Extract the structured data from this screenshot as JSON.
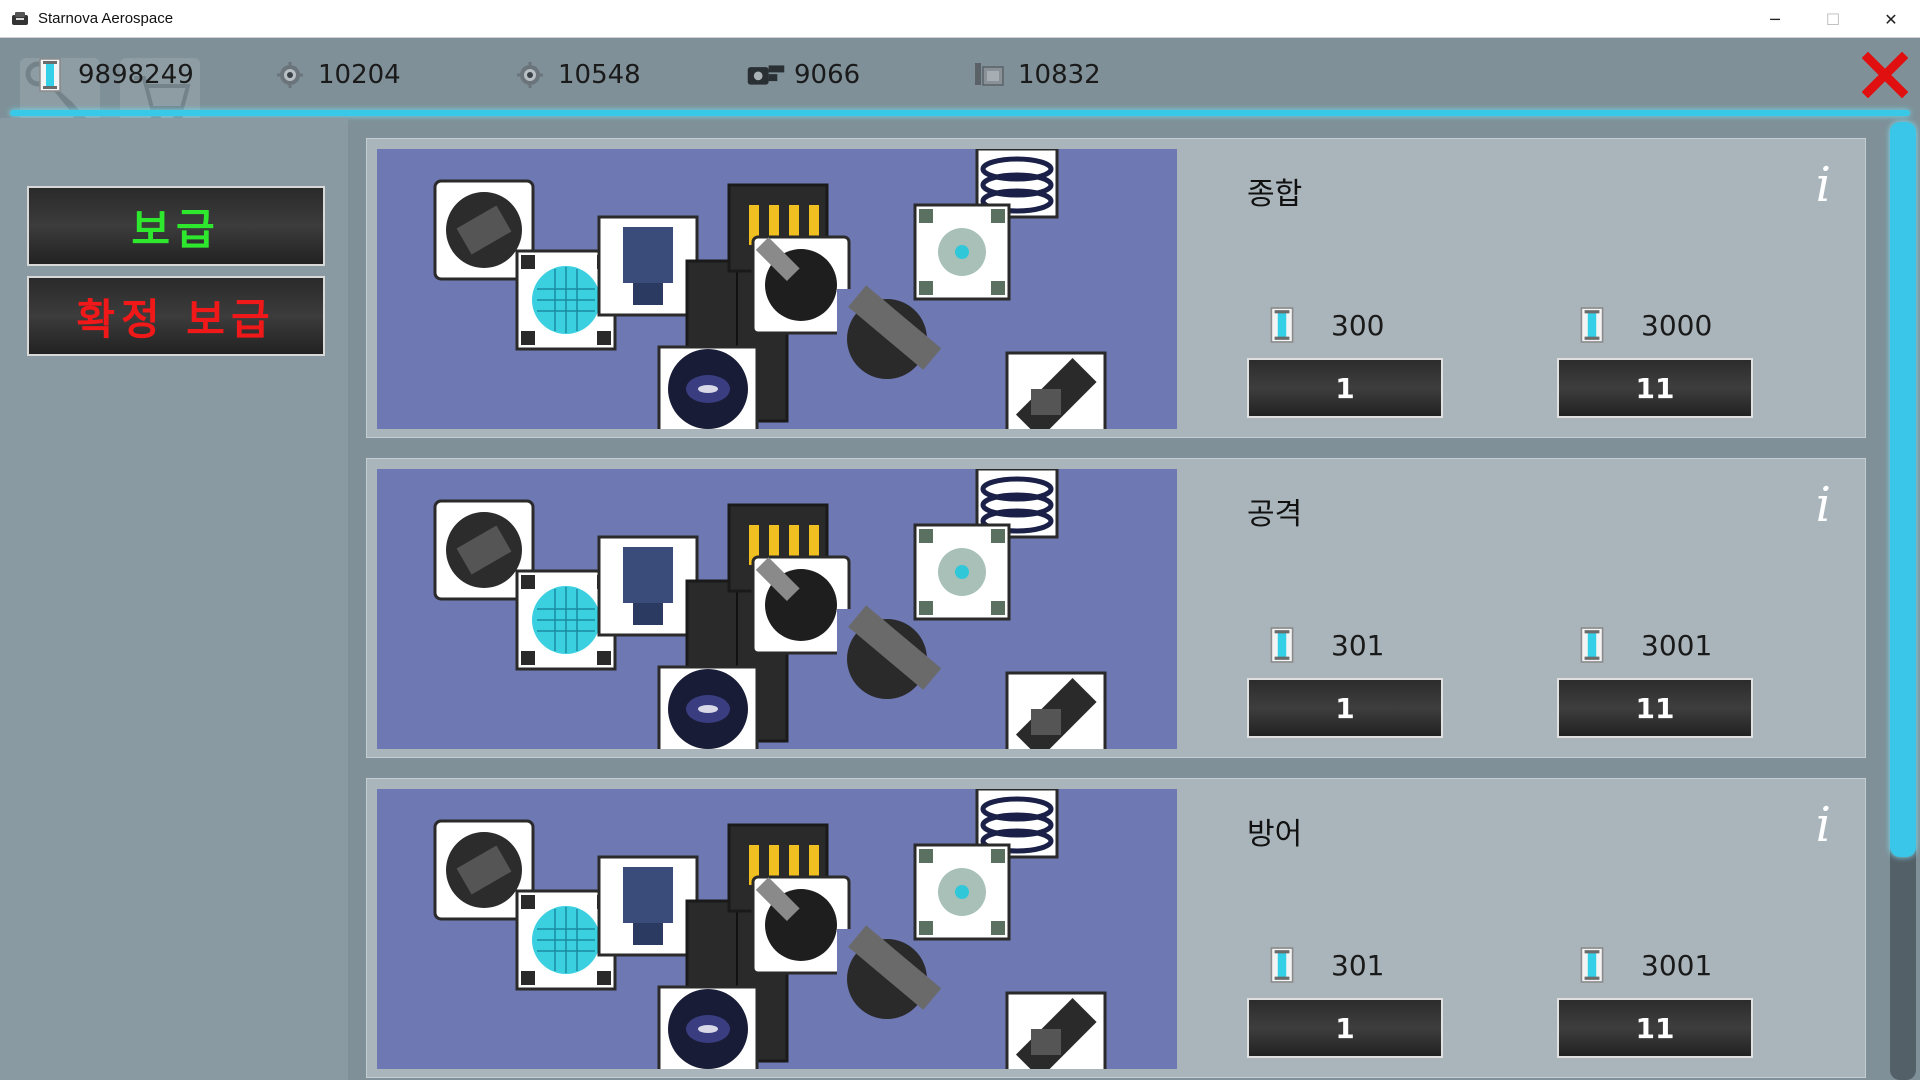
{
  "window": {
    "title": "Starnova Aerospace",
    "controls": {
      "minimize": "─",
      "maximize": "☐",
      "close": "✕"
    }
  },
  "resources": [
    {
      "icon": "crystal-icon",
      "value": "9898249"
    },
    {
      "icon": "gear-part-icon",
      "value": "10204"
    },
    {
      "icon": "gear-part-icon",
      "value": "10548"
    },
    {
      "icon": "gun-icon",
      "value": "9066"
    },
    {
      "icon": "module-icon",
      "value": "10832"
    }
  ],
  "sidebar": {
    "supply_label": "보급",
    "guaranteed_supply_label": "확정 보급"
  },
  "cards": [
    {
      "name": "종합",
      "info": "i",
      "single": {
        "cost": "300",
        "label": "1"
      },
      "multi": {
        "cost": "3000",
        "label": "11"
      }
    },
    {
      "name": "공격",
      "info": "i",
      "single": {
        "cost": "301",
        "label": "1"
      },
      "multi": {
        "cost": "3001",
        "label": "11"
      }
    },
    {
      "name": "방어",
      "info": "i",
      "single": {
        "cost": "301",
        "label": "1"
      },
      "multi": {
        "cost": "3001",
        "label": "11"
      }
    }
  ],
  "colors": {
    "accent": "#38c8e8",
    "supply_text": "#2ee82e",
    "guaranteed_text": "#f01818",
    "close_x": "#e01010",
    "card_art_bg": "#6e78b3"
  }
}
